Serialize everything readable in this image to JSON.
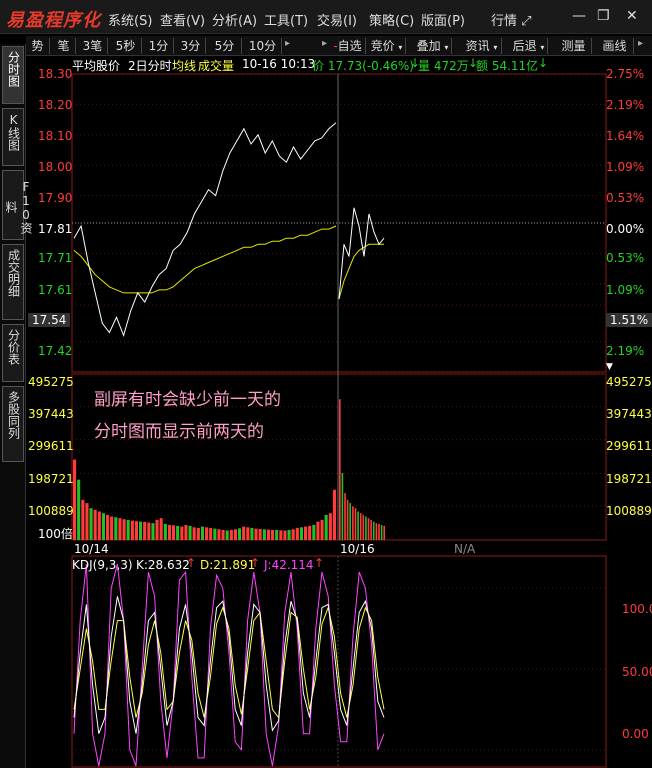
{
  "app": {
    "logo": "易盈程序化"
  },
  "menu": [
    "系统(S)",
    "查看(V)",
    "分析(A)",
    "工具(T)",
    "交易(I)",
    "策略(C)",
    "版面(P)"
  ],
  "window_controls": {
    "market_label": "行情",
    "maximize_icon": "maximize-icon",
    "minimize_icon": "minimize-icon",
    "restore_icon": "restore-icon",
    "close_icon": "close-icon"
  },
  "toolbar": {
    "periods": [
      "势",
      "笔",
      "3笔",
      "5秒",
      "1分",
      "3分",
      "5分",
      "10分"
    ],
    "tools": [
      "自选",
      "竞价",
      "叠加",
      "资讯",
      "后退",
      "测量",
      "画线"
    ]
  },
  "left_tabs": [
    "分时图",
    "K线图",
    "F10资料",
    "成交明细",
    "分价表",
    "多股同列"
  ],
  "header": {
    "items": [
      "平均股价",
      "2日分时",
      "均线",
      "成交量"
    ],
    "datetime": "10-16 10:13",
    "price": "价 17.73(-0.46%)",
    "volume": "量 472万",
    "amount": "额 54.11亿"
  },
  "price_axis_left": [
    "18.30",
    "18.20",
    "18.10",
    "18.00",
    "17.90",
    "17.81",
    "17.71",
    "17.61",
    "17.54",
    "17.42"
  ],
  "price_axis_right": [
    "2.75%",
    "2.19%",
    "1.64%",
    "1.09%",
    "0.53%",
    "0.00%",
    "0.53%",
    "1.09%",
    "1.51%",
    "2.19%"
  ],
  "volume_axis": [
    "495275",
    "397443",
    "299611",
    "198721",
    "100889",
    "100倍"
  ],
  "volume_axis_right": [
    "495275",
    "397443",
    "299611",
    "198721",
    "100889"
  ],
  "date_labels": [
    "10/14",
    "10/16"
  ],
  "na_label": "N/A",
  "kdj": {
    "title": "KDJ(9,3,3)",
    "k": "K:28.632",
    "d": "D:21.891",
    "j": "J:42.114",
    "axis": [
      "100.00",
      "50.00",
      "0.00"
    ]
  },
  "annotation": [
    "副屏有时会缺少前一天的",
    "分时图而显示前两天的"
  ],
  "chart_data": {
    "type": "line",
    "title": "",
    "ylim": [
      17.32,
      18.3
    ],
    "day1_price": [
      17.76,
      17.8,
      17.68,
      17.58,
      17.48,
      17.45,
      17.5,
      17.44,
      17.52,
      17.58,
      17.55,
      17.6,
      17.64,
      17.66,
      17.72,
      17.74,
      17.78,
      17.84,
      17.88,
      17.92,
      17.9,
      17.98,
      18.04,
      18.08,
      18.12,
      18.07,
      18.1,
      18.04,
      18.08,
      18.03,
      18.01,
      18.06,
      18.02,
      18.05,
      18.08,
      18.09,
      18.12,
      18.14
    ],
    "day1_avg": [
      17.72,
      17.7,
      17.67,
      17.64,
      17.62,
      17.6,
      17.59,
      17.58,
      17.58,
      17.58,
      17.58,
      17.58,
      17.59,
      17.59,
      17.6,
      17.62,
      17.64,
      17.66,
      17.67,
      17.68,
      17.69,
      17.7,
      17.71,
      17.72,
      17.73,
      17.73,
      17.74,
      17.74,
      17.75,
      17.75,
      17.76,
      17.76,
      17.77,
      17.77,
      17.78,
      17.79,
      17.79,
      17.8
    ],
    "day2_price": [
      17.56,
      17.74,
      17.7,
      17.86,
      17.8,
      17.7,
      17.84,
      17.78,
      17.74,
      17.76
    ],
    "day2_avg": [
      17.56,
      17.62,
      17.66,
      17.7,
      17.72,
      17.73,
      17.74,
      17.74,
      17.74,
      17.74
    ],
    "volume_ylim": [
      0,
      495275
    ],
    "volume_day1": [
      240000,
      180000,
      120000,
      110000,
      95000,
      90000,
      85000,
      80000,
      75000,
      70000,
      68000,
      65000,
      62000,
      60000,
      58000,
      56000,
      55000,
      54000,
      52000,
      50000,
      60000,
      65000,
      48000,
      45000,
      44000,
      42000,
      40000,
      45000,
      42000,
      38000,
      36000,
      40000,
      38000,
      36000,
      34000,
      32000,
      30000,
      28000,
      30000,
      32000,
      35000,
      40000,
      38000,
      36000,
      34000,
      33000,
      32000,
      31000,
      30000,
      30000,
      29000,
      28000,
      30000,
      32000,
      36000,
      38000,
      40000,
      42000,
      45000,
      55000,
      60000,
      75000,
      80000,
      150000
    ],
    "volume_day2": [
      420000,
      200000,
      140000,
      120000,
      110000,
      100000,
      95000,
      85000,
      80000,
      75000,
      70000,
      65000,
      60000,
      55000,
      50000,
      48000,
      45000,
      42000
    ],
    "kdj_ylim": [
      -10,
      115
    ],
    "kdj_k": [
      20,
      60,
      90,
      40,
      10,
      20,
      70,
      95,
      80,
      30,
      10,
      40,
      80,
      85,
      50,
      15,
      30,
      75,
      90,
      60,
      20,
      15,
      55,
      88,
      92,
      70,
      25,
      15,
      60,
      90,
      85,
      40,
      12,
      18,
      65,
      92,
      80,
      35,
      20,
      55,
      88,
      90,
      60,
      25,
      15,
      50,
      85,
      92,
      75,
      30,
      20
    ],
    "kdj_d": [
      25,
      50,
      75,
      55,
      25,
      25,
      55,
      80,
      80,
      45,
      20,
      35,
      65,
      80,
      60,
      25,
      30,
      60,
      80,
      68,
      35,
      20,
      45,
      78,
      88,
      75,
      40,
      22,
      50,
      80,
      85,
      55,
      25,
      20,
      55,
      85,
      82,
      50,
      25,
      45,
      78,
      88,
      70,
      35,
      20,
      40,
      75,
      88,
      80,
      45,
      25
    ],
    "kdj_j": [
      10,
      80,
      115,
      10,
      -10,
      10,
      100,
      115,
      80,
      0,
      -10,
      50,
      110,
      95,
      30,
      -5,
      30,
      105,
      110,
      45,
      -5,
      -5,
      75,
      108,
      100,
      60,
      5,
      0,
      80,
      110,
      85,
      10,
      -10,
      15,
      85,
      110,
      75,
      10,
      10,
      75,
      110,
      95,
      40,
      5,
      5,
      70,
      110,
      100,
      65,
      0,
      10
    ]
  }
}
